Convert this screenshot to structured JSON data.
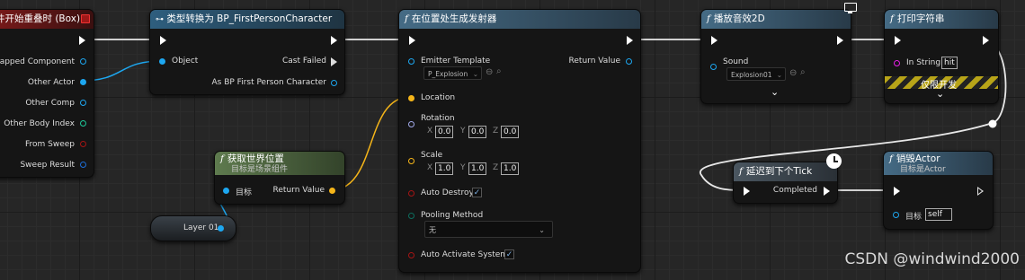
{
  "nodes": {
    "overlap": {
      "title": "件开始重叠时 (Box)",
      "pins": [
        "erlapped Component",
        "Other Actor",
        "Other Comp",
        "Other Body Index",
        "From Sweep",
        "Sweep Result"
      ]
    },
    "cast": {
      "title": "类型转换为 BP_FirstPersonCharacter",
      "object": "Object",
      "cast_failed": "Cast Failed",
      "as_bp": "As BP First Person Character"
    },
    "getloc": {
      "title": "获取世界位置",
      "subtitle": "目标是场景组件",
      "target": "目标",
      "return_value": "Return Value"
    },
    "layer": {
      "title": "Layer 01"
    },
    "spawn": {
      "title": "在位置处生成发射器",
      "emitter_template": "Emitter Template",
      "emitter_value": "P_Explosion",
      "return_value": "Return Value",
      "location": "Location",
      "rotation": "Rotation",
      "rot": [
        "0.0",
        "0.0",
        "0.0"
      ],
      "scale": "Scale",
      "scl": [
        "1.0",
        "1.0",
        "1.0"
      ],
      "auto_destroy": "Auto Destroy",
      "pooling_method": "Pooling Method",
      "pooling_value": "无",
      "auto_activate": "Auto Activate System"
    },
    "sound": {
      "title": "播放音效2D",
      "sound": "Sound",
      "sound_value": "Explosion01"
    },
    "print": {
      "title": "打印字符串",
      "in_string": "In String",
      "in_string_value": "hit",
      "dev_only": "仅限开发"
    },
    "delay": {
      "title": "延迟到下个Tick",
      "completed": "Completed"
    },
    "destroy": {
      "title": "销毁Actor",
      "subtitle": "目标是Actor",
      "target": "目标",
      "target_value": "self"
    }
  },
  "axis_labels": [
    "X",
    "Y",
    "Z"
  ],
  "watermark": "CSDN @windwind2000",
  "colors": {
    "exec": "#ffffff",
    "object": "#1da7f0",
    "vector": "#f5b519",
    "rotator": "#a0a8e8",
    "bool": "#8b1010",
    "byte": "#0d6e5e",
    "string": "#e61ee6",
    "struct": "#1260c8"
  }
}
